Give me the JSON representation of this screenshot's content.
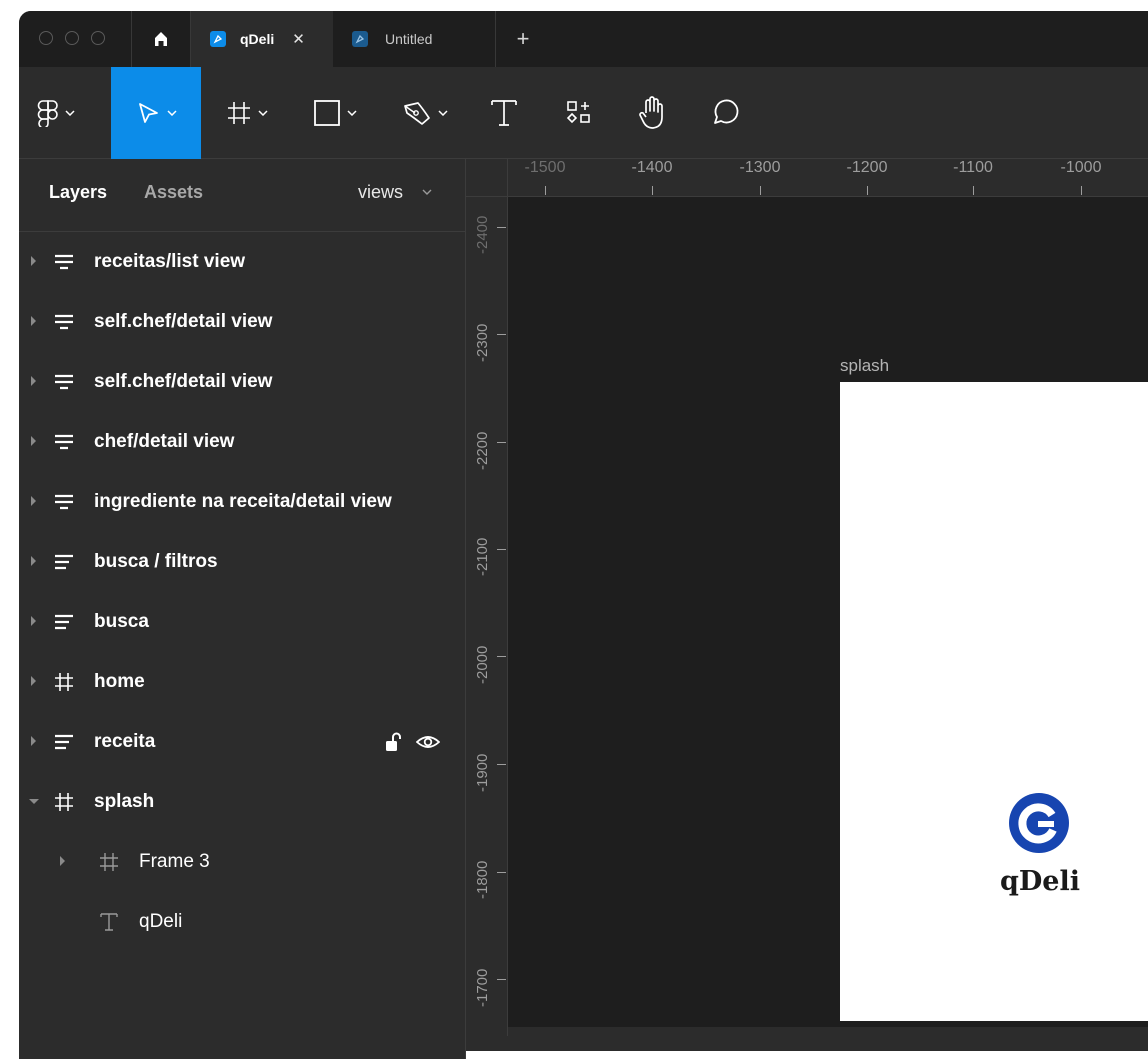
{
  "tabs": [
    {
      "label": "qDeli",
      "close": "✕",
      "active": true
    },
    {
      "label": "Untitled",
      "active": false
    }
  ],
  "new_tab": "+",
  "toolbar": {
    "tools": [
      "figma-menu",
      "move",
      "frame",
      "shape",
      "pen",
      "text",
      "resources",
      "hand",
      "comment"
    ],
    "active_tool": "move",
    "accent_color": "#0c8ce9"
  },
  "panel": {
    "tab_layers": "Layers",
    "tab_assets": "Assets",
    "page": "views"
  },
  "layers": [
    {
      "name": "receitas/list view",
      "icon": "section-icon",
      "expanded": false
    },
    {
      "name": "self.chef/detail view",
      "icon": "section-icon",
      "expanded": false
    },
    {
      "name": "self.chef/detail view",
      "icon": "section-icon",
      "expanded": false
    },
    {
      "name": "chef/detail view",
      "icon": "section-icon",
      "expanded": false
    },
    {
      "name": "ingrediente na receita/detail view",
      "icon": "section-icon",
      "expanded": false
    },
    {
      "name": "busca / filtros",
      "icon": "autolayout-icon",
      "expanded": false
    },
    {
      "name": "busca",
      "icon": "autolayout-icon",
      "expanded": false
    },
    {
      "name": "home",
      "icon": "frame-icon",
      "expanded": false
    },
    {
      "name": "receita",
      "icon": "autolayout-icon",
      "expanded": false,
      "hovered": true
    },
    {
      "name": "splash",
      "icon": "frame-icon",
      "expanded": true
    },
    {
      "name": "Frame 3",
      "icon": "frame-icon",
      "child": true,
      "expanded": false
    },
    {
      "name": "qDeli",
      "icon": "text-icon",
      "child": true
    }
  ],
  "ruler": {
    "horizontal": [
      "-1500",
      "-1400",
      "-1300",
      "-1200",
      "-1100",
      "-1000"
    ],
    "vertical": [
      "-2400",
      "-2300",
      "-2200",
      "-2100",
      "-2000",
      "-1900",
      "-1800",
      "-1700"
    ]
  },
  "canvas": {
    "frame_name": "splash",
    "logo_text": "qDeli",
    "logo_color": "#1745b0"
  }
}
